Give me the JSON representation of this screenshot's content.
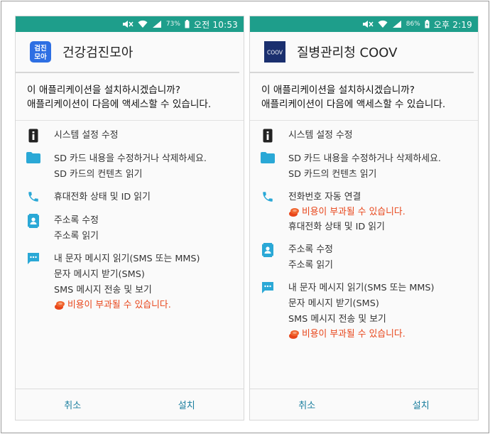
{
  "colors": {
    "statusbar": "#1e9e8b",
    "accent_text": "#1a7e9e",
    "warning": "#e8461b",
    "perm_icon": "#2aa8d6"
  },
  "left": {
    "status": {
      "battery_pct": "73%",
      "time": "오전 10:53"
    },
    "app": {
      "name": "건강검진모아",
      "icon_text_top": "검진",
      "icon_text_bottom": "모아",
      "icon_color": "#2e6fe3"
    },
    "question_line1": "이 애플리케이션을 설치하시겠습니까?",
    "question_line2": "애플리케이션이 다음에 액세스할 수 있습니다.",
    "perms": [
      {
        "icon": "system-settings-icon",
        "lines": [
          "시스템 설정 수정"
        ]
      },
      {
        "icon": "folder-icon",
        "lines": [
          "SD 카드 내용을 수정하거나 삭제하세요.",
          "SD 카드의 컨텐츠 읽기"
        ]
      },
      {
        "icon": "phone-icon",
        "lines": [
          "휴대전화 상태 및 ID 읽기"
        ]
      },
      {
        "icon": "contacts-icon",
        "lines": [
          "주소록 수정",
          "주소록 읽기"
        ]
      },
      {
        "icon": "message-icon",
        "lines": [
          "내 문자 메시지 읽기(SMS 또는 MMS)",
          "문자 메시지 받기(SMS)",
          "SMS 메시지 전송 및 보기"
        ],
        "warning": "비용이 부과될 수 있습니다."
      }
    ],
    "cancel": "취소",
    "install": "설치"
  },
  "right": {
    "status": {
      "battery_pct": "86%",
      "time": "오후 2:19"
    },
    "app": {
      "name": "질병관리청 COOV",
      "icon_text": "COOV",
      "icon_color": "#1a2f6e"
    },
    "question_line1": "이 애플리케이션을 설치하시겠습니까?",
    "question_line2": "애플리케이션이 다음에 액세스할 수 있습니다.",
    "perms": [
      {
        "icon": "system-settings-icon",
        "lines": [
          "시스템 설정 수정"
        ]
      },
      {
        "icon": "folder-icon",
        "lines": [
          "SD 카드 내용을 수정하거나 삭제하세요.",
          "SD 카드의 컨텐츠 읽기"
        ]
      },
      {
        "icon": "phone-icon",
        "lines": [
          "전화번호 자동 연결"
        ],
        "warning": "비용이 부과될 수 있습니다.",
        "lines_after": [
          "휴대전화 상태 및 ID 읽기"
        ]
      },
      {
        "icon": "contacts-icon",
        "lines": [
          "주소록 수정",
          "주소록 읽기"
        ]
      },
      {
        "icon": "message-icon",
        "lines": [
          "내 문자 메시지 읽기(SMS 또는 MMS)",
          "문자 메시지 받기(SMS)",
          "SMS 메시지 전송 및 보기"
        ],
        "warning": "비용이 부과될 수 있습니다."
      }
    ],
    "cancel": "취소",
    "install": "설치"
  }
}
